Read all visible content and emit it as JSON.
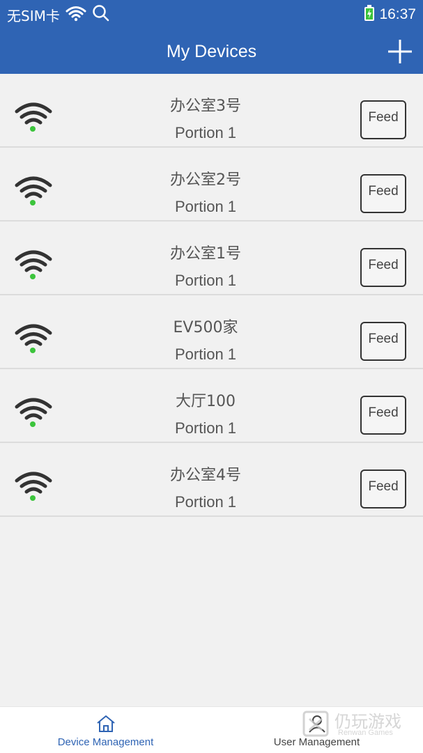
{
  "status_bar": {
    "carrier": "无SIM卡",
    "time": "16:37",
    "icons": [
      "wifi-icon",
      "search-icon",
      "battery-charging-icon"
    ]
  },
  "app_bar": {
    "title": "My Devices",
    "add_icon": "plus-icon"
  },
  "devices": [
    {
      "name": "办公室3号",
      "portion": "Portion 1",
      "feed_label": "Feed",
      "status_color": "#3cc43c"
    },
    {
      "name": "办公室2号",
      "portion": "Portion 1",
      "feed_label": "Feed",
      "status_color": "#3cc43c"
    },
    {
      "name": "办公室1号",
      "portion": "Portion 1",
      "feed_label": "Feed",
      "status_color": "#3cc43c"
    },
    {
      "name": "EV500家",
      "portion": "Portion 1",
      "feed_label": "Feed",
      "status_color": "#3cc43c"
    },
    {
      "name": "大厅100",
      "portion": "Portion 1",
      "feed_label": "Feed",
      "status_color": "#3cc43c"
    },
    {
      "name": "办公室4号",
      "portion": "Portion 1",
      "feed_label": "Feed",
      "status_color": "#3cc43c"
    }
  ],
  "tabs": [
    {
      "label": "Device Management",
      "icon": "home-icon",
      "active": true
    },
    {
      "label": "User Management",
      "icon": "user-icon",
      "active": false
    }
  ],
  "watermark": {
    "text": "仍玩游戏",
    "sub": "Renwan Games"
  },
  "colors": {
    "accent": "#2f64b4",
    "active_tab": "#2f64b4",
    "inactive_tab": "#444444",
    "online": "#3cc43c"
  }
}
